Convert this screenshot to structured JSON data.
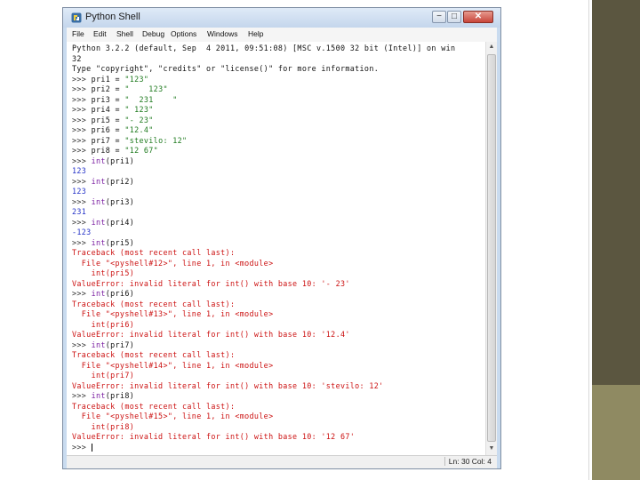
{
  "window": {
    "title": "Python Shell",
    "buttons": {
      "minimize": "−",
      "maximize": "□",
      "close": "✕"
    }
  },
  "menu": [
    "File",
    "Edit",
    "Shell",
    "Debug",
    "Options",
    "Windows",
    "Help"
  ],
  "shell_lines": [
    {
      "segments": [
        {
          "t": "Python 3.2.2 (default, Sep  4 2011, 09:51:08) [MSC v.1500 32 bit (Intel)] on win",
          "c": "out"
        }
      ]
    },
    {
      "segments": [
        {
          "t": "32",
          "c": "out"
        }
      ]
    },
    {
      "segments": [
        {
          "t": "Type \"copyright\", \"credits\" or \"license()\" for more information.",
          "c": "out"
        }
      ]
    },
    {
      "segments": [
        {
          "t": ">>> ",
          "c": "prompt"
        },
        {
          "t": "pri1 = ",
          "c": "out"
        },
        {
          "t": "\"123\"",
          "c": "str"
        }
      ]
    },
    {
      "segments": [
        {
          "t": ">>> ",
          "c": "prompt"
        },
        {
          "t": "pri2 = ",
          "c": "out"
        },
        {
          "t": "\"    123\"",
          "c": "str"
        }
      ]
    },
    {
      "segments": [
        {
          "t": ">>> ",
          "c": "prompt"
        },
        {
          "t": "pri3 = ",
          "c": "out"
        },
        {
          "t": "\"  231    \"",
          "c": "str"
        }
      ]
    },
    {
      "segments": [
        {
          "t": ">>> ",
          "c": "prompt"
        },
        {
          "t": "pri4 = ",
          "c": "out"
        },
        {
          "t": "\" 123\"",
          "c": "str"
        }
      ]
    },
    {
      "segments": [
        {
          "t": ">>> ",
          "c": "prompt"
        },
        {
          "t": "pri5 = ",
          "c": "out"
        },
        {
          "t": "\"- 23\"",
          "c": "str"
        }
      ]
    },
    {
      "segments": [
        {
          "t": ">>> ",
          "c": "prompt"
        },
        {
          "t": "pri6 = ",
          "c": "out"
        },
        {
          "t": "\"12.4\"",
          "c": "str"
        }
      ]
    },
    {
      "segments": [
        {
          "t": ">>> ",
          "c": "prompt"
        },
        {
          "t": "pri7 = ",
          "c": "out"
        },
        {
          "t": "\"stevilo: 12\"",
          "c": "str"
        }
      ]
    },
    {
      "segments": [
        {
          "t": ">>> ",
          "c": "prompt"
        },
        {
          "t": "pri8 = ",
          "c": "out"
        },
        {
          "t": "\"12 67\"",
          "c": "str"
        }
      ]
    },
    {
      "segments": [
        {
          "t": ">>> ",
          "c": "prompt"
        },
        {
          "t": "int",
          "c": "kw"
        },
        {
          "t": "(pri1)",
          "c": "out"
        }
      ]
    },
    {
      "segments": [
        {
          "t": "123",
          "c": "res"
        }
      ]
    },
    {
      "segments": [
        {
          "t": ">>> ",
          "c": "prompt"
        },
        {
          "t": "int",
          "c": "kw"
        },
        {
          "t": "(pri2)",
          "c": "out"
        }
      ]
    },
    {
      "segments": [
        {
          "t": "123",
          "c": "res"
        }
      ]
    },
    {
      "segments": [
        {
          "t": ">>> ",
          "c": "prompt"
        },
        {
          "t": "int",
          "c": "kw"
        },
        {
          "t": "(pri3)",
          "c": "out"
        }
      ]
    },
    {
      "segments": [
        {
          "t": "231",
          "c": "res"
        }
      ]
    },
    {
      "segments": [
        {
          "t": ">>> ",
          "c": "prompt"
        },
        {
          "t": "int",
          "c": "kw"
        },
        {
          "t": "(pri4)",
          "c": "out"
        }
      ]
    },
    {
      "segments": [
        {
          "t": "-123",
          "c": "res"
        }
      ]
    },
    {
      "segments": [
        {
          "t": ">>> ",
          "c": "prompt"
        },
        {
          "t": "int",
          "c": "kw"
        },
        {
          "t": "(pri5)",
          "c": "out"
        }
      ]
    },
    {
      "segments": [
        {
          "t": "Traceback (most recent call last):",
          "c": "err"
        }
      ]
    },
    {
      "segments": [
        {
          "t": "  File \"<pyshell#12>\", line 1, in <module>",
          "c": "err"
        }
      ]
    },
    {
      "segments": [
        {
          "t": "    int(pri5)",
          "c": "err"
        }
      ]
    },
    {
      "segments": [
        {
          "t": "ValueError: invalid literal for int() with base 10: '- 23'",
          "c": "err"
        }
      ]
    },
    {
      "segments": [
        {
          "t": ">>> ",
          "c": "prompt"
        },
        {
          "t": "int",
          "c": "kw"
        },
        {
          "t": "(pri6)",
          "c": "out"
        }
      ]
    },
    {
      "segments": [
        {
          "t": "Traceback (most recent call last):",
          "c": "err"
        }
      ]
    },
    {
      "segments": [
        {
          "t": "  File \"<pyshell#13>\", line 1, in <module>",
          "c": "err"
        }
      ]
    },
    {
      "segments": [
        {
          "t": "    int(pri6)",
          "c": "err"
        }
      ]
    },
    {
      "segments": [
        {
          "t": "ValueError: invalid literal for int() with base 10: '12.4'",
          "c": "err"
        }
      ]
    },
    {
      "segments": [
        {
          "t": ">>> ",
          "c": "prompt"
        },
        {
          "t": "int",
          "c": "kw"
        },
        {
          "t": "(pri7)",
          "c": "out"
        }
      ]
    },
    {
      "segments": [
        {
          "t": "Traceback (most recent call last):",
          "c": "err"
        }
      ]
    },
    {
      "segments": [
        {
          "t": "  File \"<pyshell#14>\", line 1, in <module>",
          "c": "err"
        }
      ]
    },
    {
      "segments": [
        {
          "t": "    int(pri7)",
          "c": "err"
        }
      ]
    },
    {
      "segments": [
        {
          "t": "ValueError: invalid literal for int() with base 10: 'stevilo: 12'",
          "c": "err"
        }
      ]
    },
    {
      "segments": [
        {
          "t": ">>> ",
          "c": "prompt"
        },
        {
          "t": "int",
          "c": "kw"
        },
        {
          "t": "(pri8)",
          "c": "out"
        }
      ]
    },
    {
      "segments": [
        {
          "t": "Traceback (most recent call last):",
          "c": "err"
        }
      ]
    },
    {
      "segments": [
        {
          "t": "  File \"<pyshell#15>\", line 1, in <module>",
          "c": "err"
        }
      ]
    },
    {
      "segments": [
        {
          "t": "    int(pri8)",
          "c": "err"
        }
      ]
    },
    {
      "segments": [
        {
          "t": "ValueError: invalid literal for int() with base 10: '12 67'",
          "c": "err"
        }
      ]
    },
    {
      "segments": [
        {
          "t": ">>> ",
          "c": "prompt"
        }
      ],
      "cursor": true
    }
  ],
  "status": {
    "position": "Ln: 30 Col: 4"
  },
  "colors": {
    "output": "#111111",
    "keyword": "#7a1ea1",
    "string": "#1e7a1e",
    "result": "#2533c8",
    "error": "#cc1111",
    "slide_accent_dark": "#5b5640",
    "slide_accent_light": "#8f8a62"
  },
  "icons": {
    "app": "python-idle-icon",
    "scroll_up": "arrow-up-icon",
    "scroll_down": "arrow-down-icon"
  }
}
